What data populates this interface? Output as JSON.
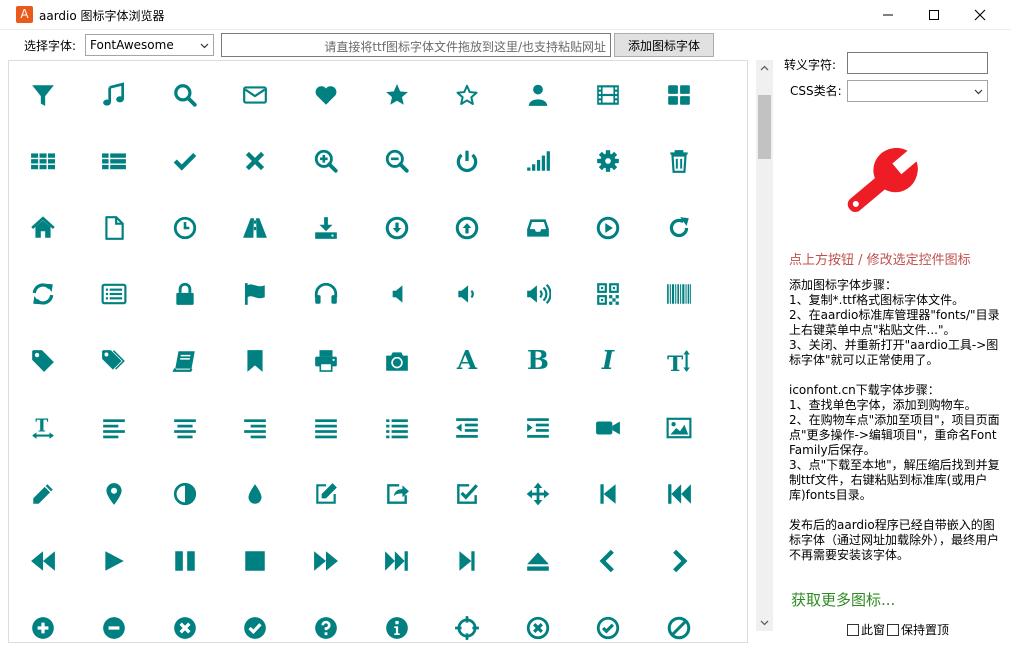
{
  "window": {
    "app_icon_letter": "A",
    "title": "aardio 图标字体浏览器"
  },
  "toolbar": {
    "font_label": "选择字体:",
    "font_selected": "FontAwesome",
    "file_placeholder": "请直接将ttf图标字体文件拖放到这里/也支持粘贴网址",
    "add_font_label": "添加图标字体"
  },
  "icon_color": "#008080",
  "wrench_color": "#ee1c25",
  "icons": [
    [
      "filter-icon",
      "music-icon",
      "search-icon",
      "envelope-icon",
      "heart-icon",
      "star-icon",
      "star-outline-icon",
      "user-icon",
      "film-icon",
      "th-large-icon"
    ],
    [
      "th-icon",
      "th-list-icon",
      "check-icon",
      "times-icon",
      "zoom-in-icon",
      "zoom-out-icon",
      "power-icon",
      "signal-icon",
      "cog-icon",
      "trash-icon"
    ],
    [
      "home-icon",
      "file-icon",
      "clock-icon",
      "road-icon",
      "download-icon",
      "arrow-circle-down-icon",
      "arrow-circle-up-icon",
      "inbox-icon",
      "play-circle-icon",
      "repeat-icon"
    ],
    [
      "refresh-icon",
      "list-alt-icon",
      "lock-icon",
      "flag-icon",
      "headphones-icon",
      "volume-off-icon",
      "volume-down-icon",
      "volume-up-icon",
      "qrcode-icon",
      "barcode-icon"
    ],
    [
      "tag-icon",
      "tags-icon",
      "book-icon",
      "bookmark-icon",
      "print-icon",
      "camera-icon",
      "font-icon",
      "bold-icon",
      "italic-icon",
      "text-height-icon"
    ],
    [
      "text-width-icon",
      "align-left-icon",
      "align-center-icon",
      "align-right-icon",
      "align-justify-icon",
      "list-icon",
      "outdent-icon",
      "indent-icon",
      "video-camera-icon",
      "picture-icon"
    ],
    [
      "pencil-icon",
      "map-marker-icon",
      "adjust-icon",
      "tint-icon",
      "edit-icon",
      "share-square-icon",
      "check-square-icon",
      "arrows-icon",
      "step-backward-icon",
      "fast-backward-icon"
    ],
    [
      "backward-icon",
      "play-icon",
      "pause-icon",
      "stop-icon",
      "forward-icon",
      "fast-forward-icon",
      "step-forward-icon",
      "eject-icon",
      "chevron-left-icon",
      "chevron-right-icon"
    ],
    [
      "plus-circle-icon",
      "minus-circle-icon",
      "times-circle-icon",
      "check-circle-icon",
      "question-circle-icon",
      "info-circle-icon",
      "crosshairs-icon",
      "times-circle-o-icon",
      "check-circle-o-icon",
      "ban-icon"
    ]
  ],
  "glyph_text": {
    "font-icon": "A",
    "bold-icon": "B",
    "italic-icon": "I"
  },
  "panel": {
    "escape_label": "转义字符:",
    "css_label": "CSS类名:",
    "hint": "点上方按钮 / 修改选定控件图标",
    "steps1": "添加图标字体步骤：\n1、复制*.ttf格式图标字体文件。\n2、在aardio标准库管理器\"fonts/\"目录上右键菜单中点\"粘贴文件...\"。\n3、关闭、并重新打开\"aardio工具->图标字体\"就可以正常使用了。",
    "steps2": "iconfont.cn下载字体步骤：\n1、查找单色字体，添加到购物车。\n2、在购物车点\"添加至项目\"，项目页面点\"更多操作->编辑项目\"，重命名Font Family后保存。\n3、点\"下载至本地\"，解压缩后找到并复制ttf文件，右键粘贴到标准库(或用户库)fonts目录。",
    "steps3": "发布后的aardio程序已经自带嵌入的图标字体（通过网址加载除外），最终用户不再需要安装该字体。",
    "more_link": "获取更多图标...",
    "topmost_a": "此窗",
    "topmost_b": "保持置顶"
  }
}
